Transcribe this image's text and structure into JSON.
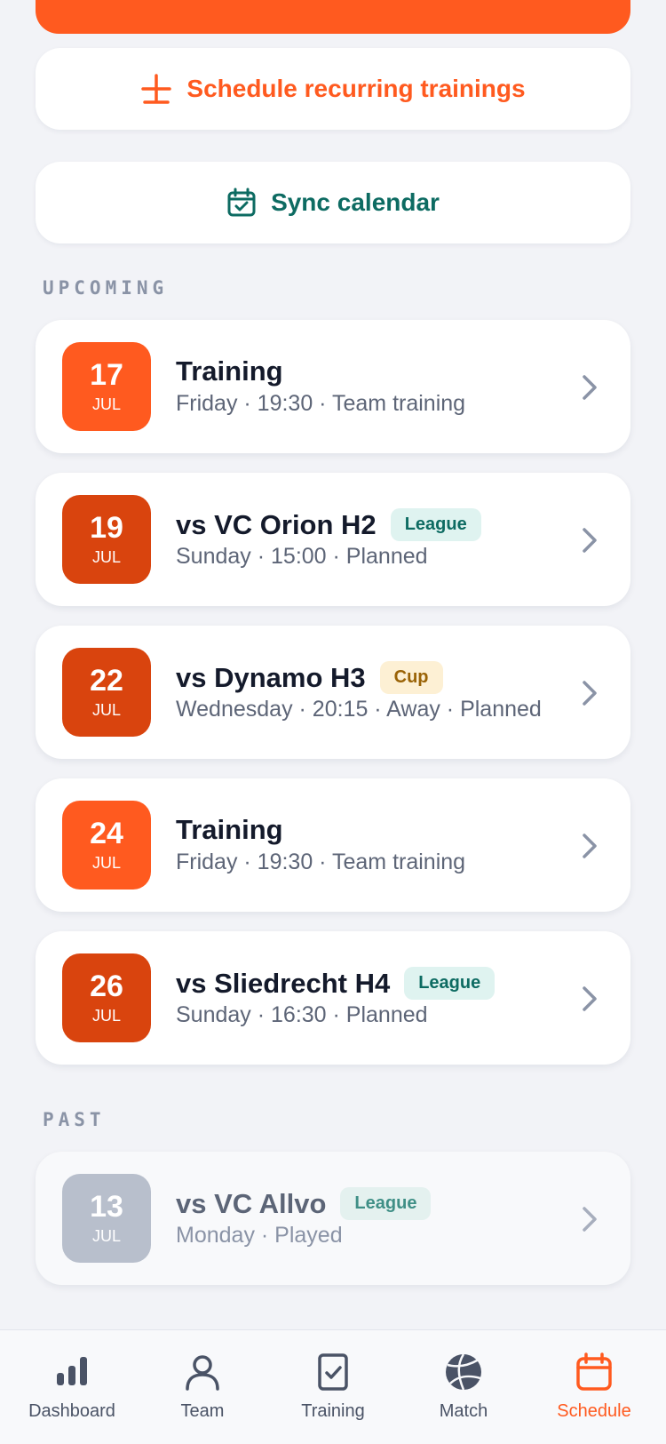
{
  "actions": {
    "recurring_label": "Schedule recurring trainings",
    "sync_label": "Sync calendar"
  },
  "sections": {
    "upcoming": "UPCOMING",
    "past": "PAST"
  },
  "upcoming": [
    {
      "day": "17",
      "month": "JUL",
      "title": "Training",
      "badge": "",
      "subtitle": "Friday · 19:30 · Team training",
      "kind": "training"
    },
    {
      "day": "19",
      "month": "JUL",
      "title": "vs VC Orion H2",
      "badge": "League",
      "subtitle": "Sunday · 15:00 · Planned",
      "kind": "match"
    },
    {
      "day": "22",
      "month": "JUL",
      "title": "vs Dynamo H3",
      "badge": "Cup",
      "subtitle": "Wednesday · 20:15 · Away · Planned",
      "kind": "match"
    },
    {
      "day": "24",
      "month": "JUL",
      "title": "Training",
      "badge": "",
      "subtitle": "Friday · 19:30 · Team training",
      "kind": "training"
    },
    {
      "day": "26",
      "month": "JUL",
      "title": "vs Sliedrecht H4",
      "badge": "League",
      "subtitle": "Sunday · 16:30 · Planned",
      "kind": "match"
    }
  ],
  "past": [
    {
      "day": "13",
      "month": "JUL",
      "title": "vs VC Allvo",
      "badge": "League",
      "subtitle": "Monday · Played",
      "kind": "past"
    }
  ],
  "nav": {
    "dashboard": "Dashboard",
    "team": "Team",
    "training": "Training",
    "match": "Match",
    "schedule": "Schedule",
    "active": "schedule"
  },
  "colors": {
    "accent": "#ff5a1f",
    "match_date": "#d9440e",
    "teal": "#0d6b62",
    "past_date": "#b8bfcc"
  }
}
